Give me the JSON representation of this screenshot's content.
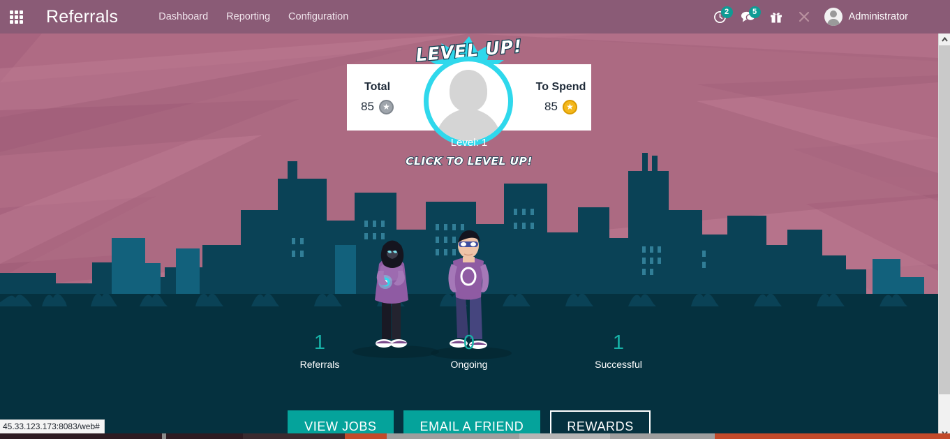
{
  "window": {
    "status_url": "45.33.123.173:8083/web#"
  },
  "navbar": {
    "apps_icon": "apps-grid-icon",
    "brand": "Referrals",
    "menu_items": [
      {
        "label": "Dashboard"
      },
      {
        "label": "Reporting"
      },
      {
        "label": "Configuration"
      }
    ],
    "icons": [
      {
        "name": "activity-clock-icon",
        "badge": "2"
      },
      {
        "name": "messages-chat-icon",
        "badge": "5"
      },
      {
        "name": "gift-icon",
        "badge": ""
      },
      {
        "name": "tools-wrench-icon",
        "badge": ""
      }
    ],
    "user": {
      "name": "Administrator",
      "avatar_icon": "user-avatar-icon"
    },
    "bg_color": "#8a5b76"
  },
  "hero": {
    "level_up_banner": "LEVEL UP!",
    "avatar_icon": "placeholder-person-avatar",
    "card": {
      "left": {
        "label": "Total",
        "value": "85",
        "coin_icon": "grey-star-coin",
        "coin_glyph": "★"
      },
      "right": {
        "label": "To Spend",
        "value": "85",
        "coin_icon": "gold-star-coin",
        "coin_glyph": "★"
      }
    },
    "level_label": "Level: 1",
    "click_to_level_up": "CLICK TO LEVEL UP!",
    "ring_color": "#2fd8ec"
  },
  "stats": [
    {
      "value": "1",
      "name": "Referrals"
    },
    {
      "value": "0",
      "name": "Ongoing"
    },
    {
      "value": "1",
      "name": "Successful"
    }
  ],
  "actions": [
    {
      "label": "VIEW JOBS",
      "style": "primary"
    },
    {
      "label": "EMAIL A FRIEND",
      "style": "primary"
    },
    {
      "label": "REWARDS",
      "style": "outline"
    }
  ],
  "theme": {
    "sky": "#a8647f",
    "ground": "#05313f",
    "city": "#0a4256",
    "teal": "#18b2a8",
    "button_teal": "#05a39b"
  },
  "scrollbar": {
    "up_icon": "chevron-up-icon",
    "down_icon": "chevron-down-icon"
  }
}
